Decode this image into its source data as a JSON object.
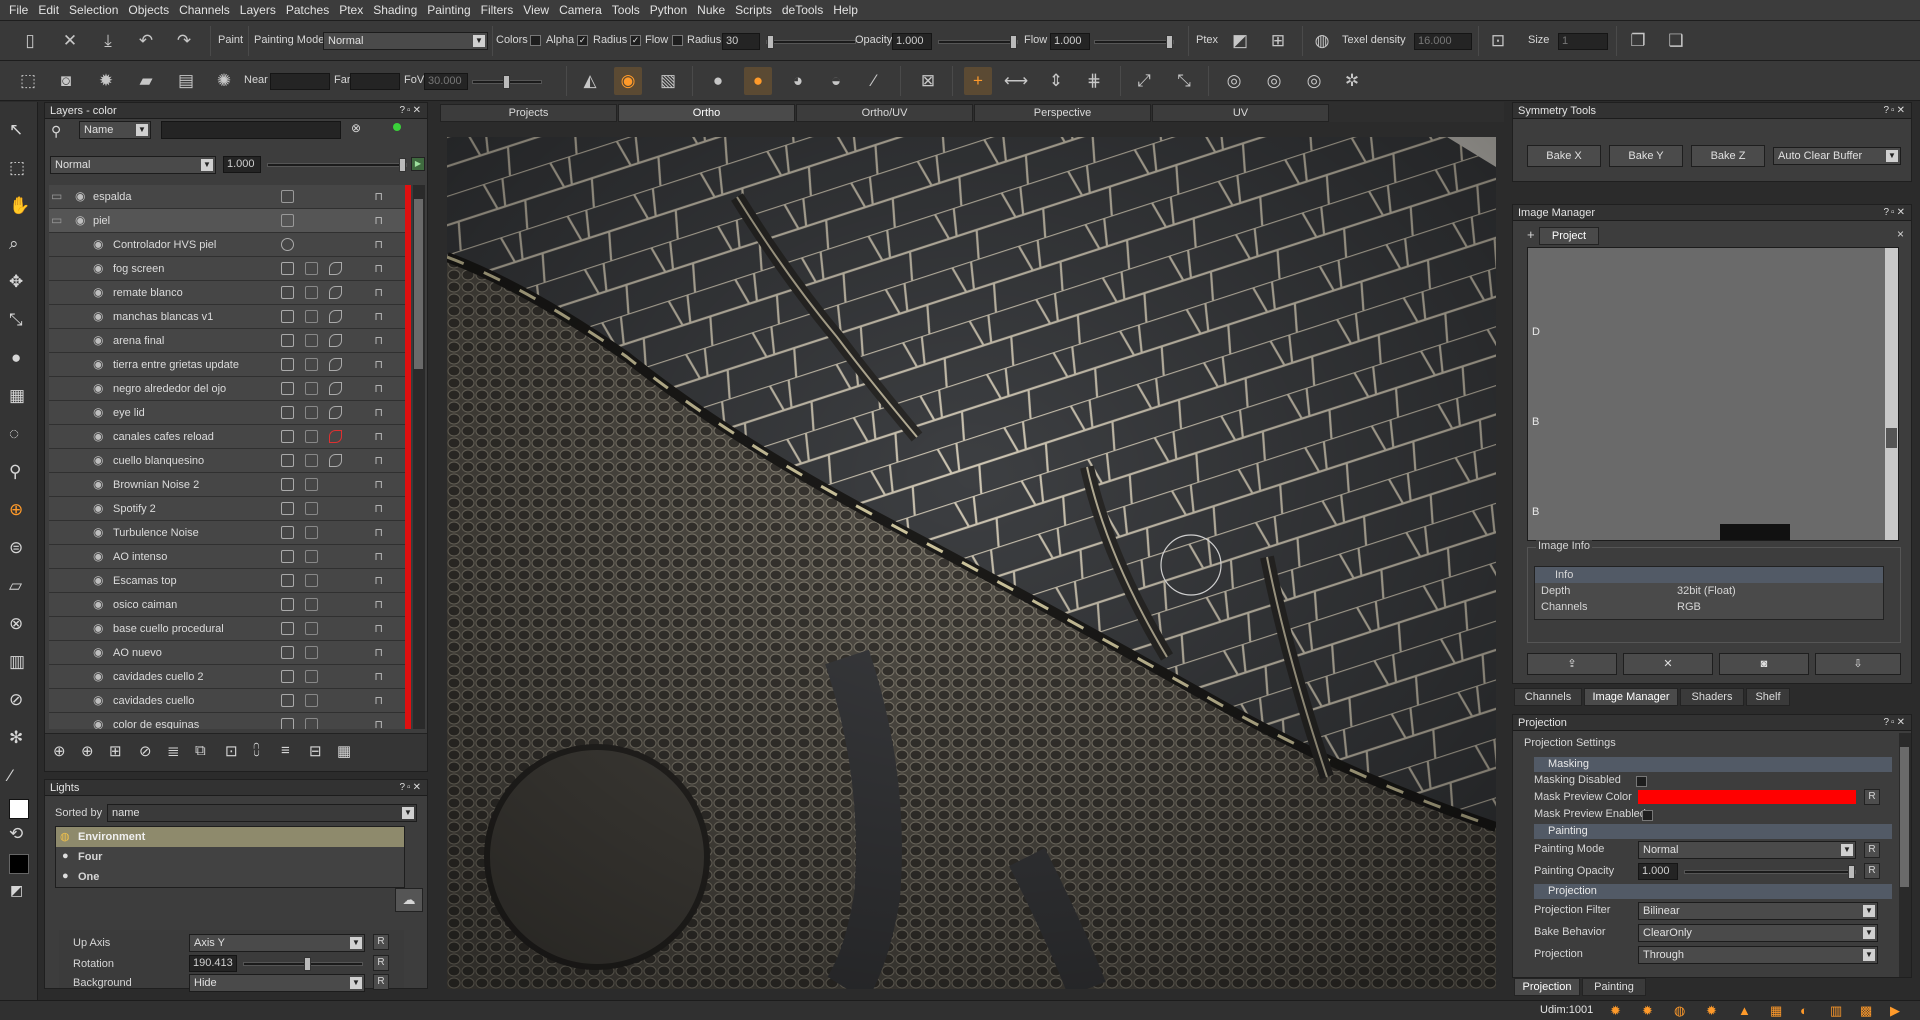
{
  "menu": [
    "File",
    "Edit",
    "Selection",
    "Objects",
    "Channels",
    "Layers",
    "Patches",
    "Ptex",
    "Shading",
    "Painting",
    "Filters",
    "View",
    "Camera",
    "Tools",
    "Python",
    "Nuke",
    "Scripts",
    "deTools",
    "Help"
  ],
  "toolbar1": {
    "paint_label": "Paint",
    "painting_mode_label": "Painting Mode",
    "painting_mode_value": "Normal",
    "colors_label": "Colors",
    "alpha_label": "Alpha",
    "radius_check_label": "Radius",
    "flow_check_label": "Flow",
    "radius_label": "Radius",
    "radius_value": "30",
    "opacity_label": "Opacity",
    "opacity_value": "1.000",
    "flow_label": "Flow",
    "flow_value": "1.000",
    "ptex_label": "Ptex",
    "texel_density_label": "Texel density",
    "texel_density_value": "16.000",
    "size_label": "Size",
    "size_value": "1"
  },
  "toolbar2": {
    "near_label": "Near",
    "near_value": "",
    "far_label": "Far",
    "far_value": "",
    "fov_label": "FoV",
    "fov_value": "30.000"
  },
  "layers_panel": {
    "title": "Layers - color",
    "filter_combo": "Name",
    "blend_mode": "Normal",
    "opacity": "1.000",
    "layers": [
      {
        "name": "espalda",
        "type": "group"
      },
      {
        "name": "piel",
        "type": "group"
      },
      {
        "name": "Controlador HVS piel",
        "type": "adj"
      },
      {
        "name": "fog screen",
        "type": "proc"
      },
      {
        "name": "remate blanco",
        "type": "proc"
      },
      {
        "name": "manchas blancas v1",
        "type": "paint"
      },
      {
        "name": "arena final",
        "type": "paint"
      },
      {
        "name": "tierra entre grietas update",
        "type": "paint"
      },
      {
        "name": "negro alrededor del ojo",
        "type": "paint"
      },
      {
        "name": "eye lid",
        "type": "proc"
      },
      {
        "name": "canales  cafes reload",
        "type": "paint"
      },
      {
        "name": "cuello blanquesino",
        "type": "paint"
      },
      {
        "name": "Brownian Noise 2",
        "type": "paint"
      },
      {
        "name": "Spotify 2",
        "type": "paint"
      },
      {
        "name": "Turbulence Noise",
        "type": "paint"
      },
      {
        "name": "AO intenso",
        "type": "paint"
      },
      {
        "name": "Escamas top",
        "type": "paint"
      },
      {
        "name": "osico caiman",
        "type": "paint"
      },
      {
        "name": "base cuello procedural",
        "type": "paint"
      },
      {
        "name": "AO nuevo",
        "type": "proc"
      },
      {
        "name": "cavidades cuello 2",
        "type": "paint"
      },
      {
        "name": "cavidades cuello",
        "type": "paint"
      },
      {
        "name": "color de esquinas",
        "type": "paint"
      }
    ]
  },
  "lights_panel": {
    "title": "Lights",
    "sorted_by_label": "Sorted by",
    "sorted_by_value": "name",
    "items": [
      "Environment",
      "Four",
      "One"
    ],
    "up_axis_label": "Up Axis",
    "up_axis_value": "Axis Y",
    "rotation_label": "Rotation",
    "rotation_value": "190.413",
    "background_label": "Background",
    "background_value": "Hide",
    "reset": "R"
  },
  "viewport_tabs": [
    "Projects",
    "Ortho",
    "Ortho/UV",
    "Perspective",
    "UV"
  ],
  "active_viewport_tab": "Ortho",
  "symmetry_panel": {
    "title": "Symmetry Tools",
    "buttons": [
      "Bake X",
      "Bake Y",
      "Bake Z"
    ],
    "combo": "Auto Clear Buffer"
  },
  "image_manager": {
    "title": "Image Manager",
    "add": "+",
    "tab": "Project",
    "close": "×",
    "row_letters": [
      "D",
      "B",
      "B"
    ],
    "image_info_label": "Image Info",
    "info_header": "Info",
    "depth_label": "Depth",
    "depth_value": "32bit (Float)",
    "channels_label": "Channels",
    "channels_value": "RGB"
  },
  "right_tabs": [
    "Channels",
    "Image Manager",
    "Shaders",
    "Shelf"
  ],
  "active_right_tab": "Image Manager",
  "projection_panel": {
    "title": "Projection",
    "settings_label": "Projection Settings",
    "masking_section": "Masking",
    "masking_disabled_label": "Masking Disabled",
    "mask_preview_color_label": "Mask Preview Color",
    "mask_preview_color": "#ff0000",
    "mask_preview_enabled_label": "Mask Preview Enabled",
    "painting_section": "Painting",
    "painting_mode_label": "Painting Mode",
    "painting_mode_value": "Normal",
    "painting_opacity_label": "Painting Opacity",
    "painting_opacity_value": "1.000",
    "projection_section": "Projection",
    "projection_filter_label": "Projection Filter",
    "projection_filter_value": "Bilinear",
    "bake_behavior_label": "Bake Behavior",
    "bake_behavior_value": "ClearOnly",
    "projection_label": "Projection",
    "projection_value": "Through",
    "reset": "R"
  },
  "bottom_tabs": [
    "Projection",
    "Painting"
  ],
  "active_bottom_tab": "Projection",
  "status": {
    "udim": "Udim:1001"
  },
  "accent_color": "#ff9a2a",
  "layer_flag_color": "#e01010"
}
